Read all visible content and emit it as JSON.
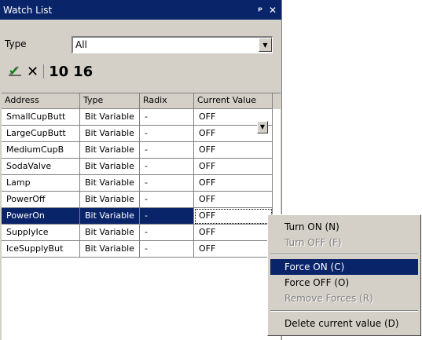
{
  "window": {
    "title": "Watch List",
    "pin_glyph": "✕",
    "close_glyph": "✕"
  },
  "type_filter": {
    "label": "Type",
    "selected": "All"
  },
  "toolbar": {
    "icons": [
      "pencil-check-icon",
      "delete-icon"
    ],
    "dec_label": "10",
    "hex_label": "16"
  },
  "grid": {
    "columns": [
      "Address",
      "Type",
      "Radix",
      "Current Value"
    ],
    "rows": [
      {
        "address": "SmallCupButt",
        "type": "Bit Variable",
        "radix": "-",
        "value": "OFF"
      },
      {
        "address": "LargeCupButt",
        "type": "Bit Variable",
        "radix": "-",
        "value": "OFF"
      },
      {
        "address": "MediumCupB",
        "type": "Bit Variable",
        "radix": "-",
        "value": "OFF"
      },
      {
        "address": "SodaValve",
        "type": "Bit Variable",
        "radix": "-",
        "value": "OFF"
      },
      {
        "address": "Lamp",
        "type": "Bit Variable",
        "radix": "-",
        "value": "OFF"
      },
      {
        "address": "PowerOff",
        "type": "Bit Variable",
        "radix": "-",
        "value": "OFF"
      },
      {
        "address": "PowerOn",
        "type": "Bit Variable",
        "radix": "-",
        "value": "OFF"
      },
      {
        "address": "SupplyIce",
        "type": "Bit Variable",
        "radix": "-",
        "value": "OFF"
      },
      {
        "address": "IceSupplyBut",
        "type": "Bit Variable",
        "radix": "-",
        "value": "OFF"
      }
    ]
  },
  "context_menu": {
    "items": [
      {
        "label": "Turn ON (N)",
        "enabled": true
      },
      {
        "label": "Turn OFF (F)",
        "enabled": false
      },
      {
        "label": "Force ON (C)",
        "enabled": true
      },
      {
        "label": "Force OFF (O)",
        "enabled": true
      },
      {
        "label": "Remove Forces (R)",
        "enabled": false
      },
      {
        "label": "Delete current value (D)",
        "enabled": true
      }
    ]
  },
  "colors": {
    "titlebar": "#0a246a",
    "selection": "#0a246a",
    "face": "#d4d0c8"
  }
}
